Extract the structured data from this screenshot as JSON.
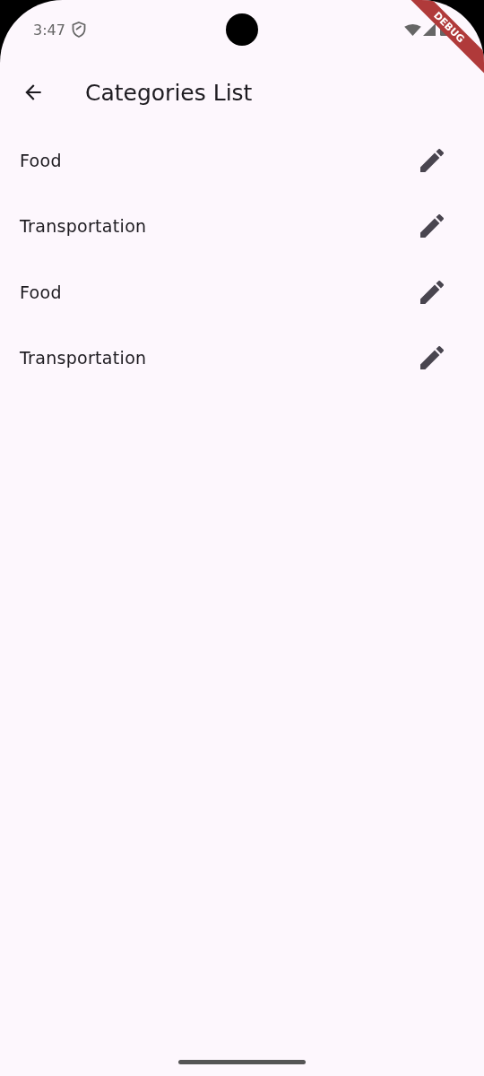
{
  "status_bar": {
    "time": "3:47"
  },
  "debug_banner": "DEBUG",
  "app_bar": {
    "title": "Categories List"
  },
  "categories": [
    {
      "name": "Food"
    },
    {
      "name": "Transportation"
    },
    {
      "name": "Food"
    },
    {
      "name": "Transportation"
    }
  ]
}
